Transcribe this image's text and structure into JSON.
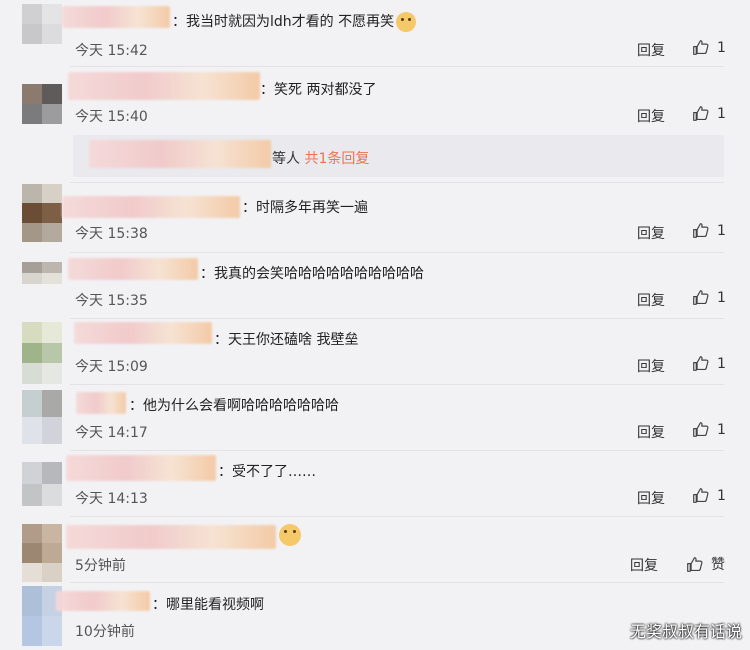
{
  "comments": [
    {
      "text": "：我当时就因为ldh才看的 不愿再笑",
      "time": "今天 15:42",
      "reply": "回复",
      "likes": "1",
      "emoji": "dog-emoji"
    },
    {
      "text": "：笑死 两对都没了",
      "time": "今天 15:40",
      "reply": "回复",
      "likes": "1"
    },
    {
      "text": "：时隔多年再笑一遍",
      "time": "今天 15:38",
      "reply": "回复",
      "likes": "1"
    },
    {
      "text": "：我真的会笑哈哈哈哈哈哈哈哈哈哈",
      "time": "今天 15:35",
      "reply": "回复",
      "likes": "1"
    },
    {
      "text": "：天王你还磕啥 我壁垒",
      "time": "今天 15:09",
      "reply": "回复",
      "likes": "1"
    },
    {
      "text": "：他为什么会看啊哈哈哈哈哈哈哈",
      "time": "今天 14:17",
      "reply": "回复",
      "likes": "1"
    },
    {
      "text": "：受不了了……",
      "time": "今天 14:13",
      "reply": "回复",
      "likes": "1"
    },
    {
      "text": "",
      "time": "5分钟前",
      "reply": "回复",
      "likes": "赞",
      "emoji": "dog-emoji"
    },
    {
      "text": "：哪里能看视频啊",
      "time": "10分钟前"
    }
  ],
  "reply_summary": {
    "prefix": "等人",
    "link": "共1条回复"
  },
  "watermark": "无奖叔叔有话说",
  "colors": {
    "link": "#eb7350",
    "background": "#f2f2f5"
  }
}
